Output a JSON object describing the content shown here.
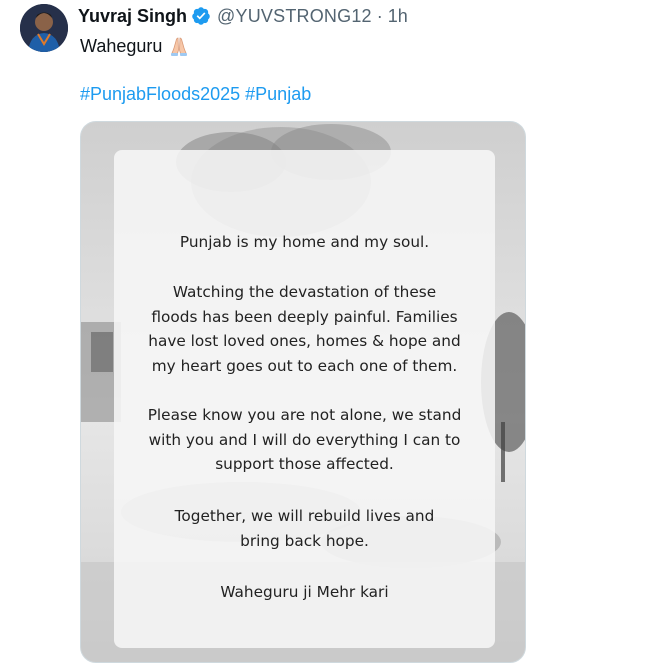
{
  "tweet": {
    "author": {
      "display_name": "Yuvraj Singh",
      "handle": "@YUVSTRONG12",
      "verified": true,
      "avatar_icon": "profile-photo"
    },
    "separator": "·",
    "timestamp": "1h",
    "text": "Waheguru",
    "emoji": "folded-hands",
    "hashtags": [
      "#PunjabFloods2025",
      "#Punjab"
    ]
  },
  "media": {
    "lines": {
      "l1": "Punjab is my home and my soul.",
      "l2": "Watching the devastation of these",
      "l3": "floods has been deeply painful. Families",
      "l4": "have lost loved ones, homes & hope and",
      "l5": "my heart goes out to each one of them.",
      "l6": "Please know you are not alone, we stand",
      "l7": "with you and I will do everything I can to",
      "l8": "support those affected.",
      "l9": "Together, we will rebuild lives and",
      "l10": "bring back hope.",
      "l11": "Waheguru ji Mehr kari"
    }
  },
  "colors": {
    "link": "#1d9bf0",
    "secondary_text": "#536471",
    "verified_badge": "#1d9bf0",
    "media_border": "#cfd9de"
  }
}
